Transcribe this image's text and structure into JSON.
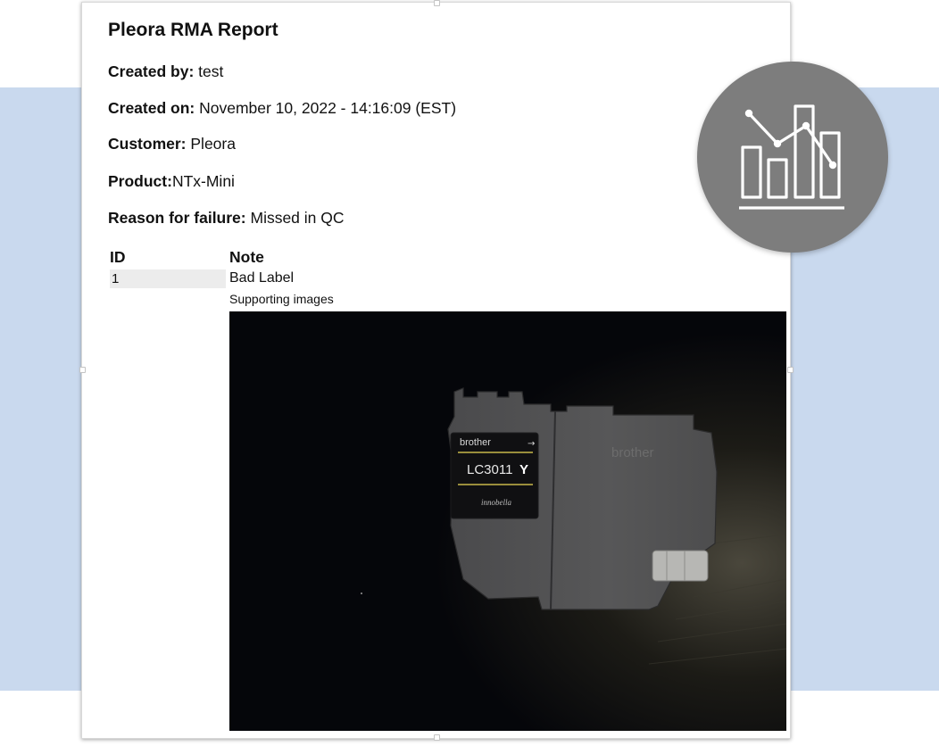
{
  "report": {
    "title": "Pleora RMA Report",
    "created_by_label": "Created by:",
    "created_by_value": " test",
    "created_on_label": "Created on:",
    "created_on_value": " November 10, 2022 - 14:16:09 (EST)",
    "customer_label": "Customer:",
    "customer_value": " Pleora",
    "product_label": "Product:",
    "product_value": "NTx-Mini",
    "reason_label": "Reason for failure:",
    "reason_value": " Missed in QC"
  },
  "table": {
    "headers": [
      "ID",
      "Note"
    ],
    "rows": [
      {
        "id": "1",
        "note": "Bad Label",
        "sub": "Supporting images"
      }
    ]
  },
  "photo": {
    "brand_label": "brother",
    "model_label": "LC3011",
    "color_code": "Y",
    "embossed_brand": "brother",
    "tag_label": "innobella"
  },
  "badge": {
    "icon": "bar-line-chart-icon"
  },
  "colors": {
    "band": "#c9d9ee",
    "badge": "#7d7d7d",
    "photo_bg": "#05060a"
  }
}
